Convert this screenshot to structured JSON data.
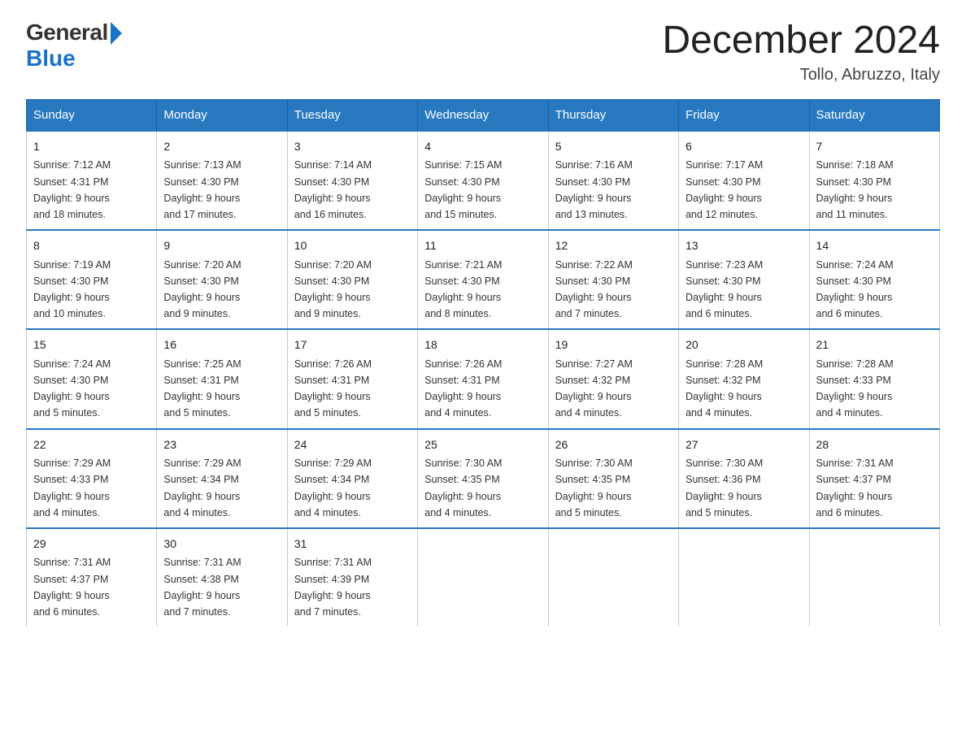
{
  "logo": {
    "general": "General",
    "blue": "Blue"
  },
  "title": "December 2024",
  "subtitle": "Tollo, Abruzzo, Italy",
  "header_accent_color": "#2878c0",
  "days_of_week": [
    "Sunday",
    "Monday",
    "Tuesday",
    "Wednesday",
    "Thursday",
    "Friday",
    "Saturday"
  ],
  "weeks": [
    [
      {
        "day": "1",
        "sunrise": "7:12 AM",
        "sunset": "4:31 PM",
        "daylight": "9 hours and 18 minutes."
      },
      {
        "day": "2",
        "sunrise": "7:13 AM",
        "sunset": "4:30 PM",
        "daylight": "9 hours and 17 minutes."
      },
      {
        "day": "3",
        "sunrise": "7:14 AM",
        "sunset": "4:30 PM",
        "daylight": "9 hours and 16 minutes."
      },
      {
        "day": "4",
        "sunrise": "7:15 AM",
        "sunset": "4:30 PM",
        "daylight": "9 hours and 15 minutes."
      },
      {
        "day": "5",
        "sunrise": "7:16 AM",
        "sunset": "4:30 PM",
        "daylight": "9 hours and 13 minutes."
      },
      {
        "day": "6",
        "sunrise": "7:17 AM",
        "sunset": "4:30 PM",
        "daylight": "9 hours and 12 minutes."
      },
      {
        "day": "7",
        "sunrise": "7:18 AM",
        "sunset": "4:30 PM",
        "daylight": "9 hours and 11 minutes."
      }
    ],
    [
      {
        "day": "8",
        "sunrise": "7:19 AM",
        "sunset": "4:30 PM",
        "daylight": "9 hours and 10 minutes."
      },
      {
        "day": "9",
        "sunrise": "7:20 AM",
        "sunset": "4:30 PM",
        "daylight": "9 hours and 9 minutes."
      },
      {
        "day": "10",
        "sunrise": "7:20 AM",
        "sunset": "4:30 PM",
        "daylight": "9 hours and 9 minutes."
      },
      {
        "day": "11",
        "sunrise": "7:21 AM",
        "sunset": "4:30 PM",
        "daylight": "9 hours and 8 minutes."
      },
      {
        "day": "12",
        "sunrise": "7:22 AM",
        "sunset": "4:30 PM",
        "daylight": "9 hours and 7 minutes."
      },
      {
        "day": "13",
        "sunrise": "7:23 AM",
        "sunset": "4:30 PM",
        "daylight": "9 hours and 6 minutes."
      },
      {
        "day": "14",
        "sunrise": "7:24 AM",
        "sunset": "4:30 PM",
        "daylight": "9 hours and 6 minutes."
      }
    ],
    [
      {
        "day": "15",
        "sunrise": "7:24 AM",
        "sunset": "4:30 PM",
        "daylight": "9 hours and 5 minutes."
      },
      {
        "day": "16",
        "sunrise": "7:25 AM",
        "sunset": "4:31 PM",
        "daylight": "9 hours and 5 minutes."
      },
      {
        "day": "17",
        "sunrise": "7:26 AM",
        "sunset": "4:31 PM",
        "daylight": "9 hours and 5 minutes."
      },
      {
        "day": "18",
        "sunrise": "7:26 AM",
        "sunset": "4:31 PM",
        "daylight": "9 hours and 4 minutes."
      },
      {
        "day": "19",
        "sunrise": "7:27 AM",
        "sunset": "4:32 PM",
        "daylight": "9 hours and 4 minutes."
      },
      {
        "day": "20",
        "sunrise": "7:28 AM",
        "sunset": "4:32 PM",
        "daylight": "9 hours and 4 minutes."
      },
      {
        "day": "21",
        "sunrise": "7:28 AM",
        "sunset": "4:33 PM",
        "daylight": "9 hours and 4 minutes."
      }
    ],
    [
      {
        "day": "22",
        "sunrise": "7:29 AM",
        "sunset": "4:33 PM",
        "daylight": "9 hours and 4 minutes."
      },
      {
        "day": "23",
        "sunrise": "7:29 AM",
        "sunset": "4:34 PM",
        "daylight": "9 hours and 4 minutes."
      },
      {
        "day": "24",
        "sunrise": "7:29 AM",
        "sunset": "4:34 PM",
        "daylight": "9 hours and 4 minutes."
      },
      {
        "day": "25",
        "sunrise": "7:30 AM",
        "sunset": "4:35 PM",
        "daylight": "9 hours and 4 minutes."
      },
      {
        "day": "26",
        "sunrise": "7:30 AM",
        "sunset": "4:35 PM",
        "daylight": "9 hours and 5 minutes."
      },
      {
        "day": "27",
        "sunrise": "7:30 AM",
        "sunset": "4:36 PM",
        "daylight": "9 hours and 5 minutes."
      },
      {
        "day": "28",
        "sunrise": "7:31 AM",
        "sunset": "4:37 PM",
        "daylight": "9 hours and 6 minutes."
      }
    ],
    [
      {
        "day": "29",
        "sunrise": "7:31 AM",
        "sunset": "4:37 PM",
        "daylight": "9 hours and 6 minutes."
      },
      {
        "day": "30",
        "sunrise": "7:31 AM",
        "sunset": "4:38 PM",
        "daylight": "9 hours and 7 minutes."
      },
      {
        "day": "31",
        "sunrise": "7:31 AM",
        "sunset": "4:39 PM",
        "daylight": "9 hours and 7 minutes."
      },
      null,
      null,
      null,
      null
    ]
  ],
  "labels": {
    "sunrise": "Sunrise:",
    "sunset": "Sunset:",
    "daylight": "Daylight:"
  }
}
